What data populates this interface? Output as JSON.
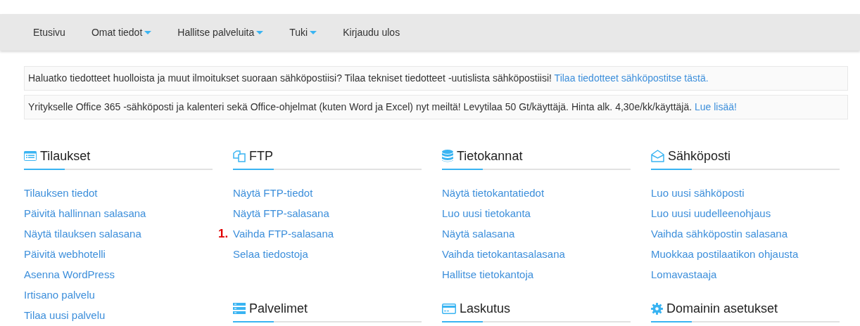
{
  "nav": [
    {
      "label": "Etusivu",
      "dropdown": false
    },
    {
      "label": "Omat tiedot",
      "dropdown": true
    },
    {
      "label": "Hallitse palveluita",
      "dropdown": true
    },
    {
      "label": "Tuki",
      "dropdown": true
    },
    {
      "label": "Kirjaudu ulos",
      "dropdown": false
    }
  ],
  "notices": [
    {
      "text": "Haluatko tiedotteet huolloista ja muut ilmoitukset suoraan sähköpostiisi? Tilaa tekniset tiedotteet -uutislista sähköpostiisi!",
      "link": "Tilaa tiedotteet sähköpostitse tästä."
    },
    {
      "text": "Yritykselle Office 365 -sähköposti ja kalenteri sekä Office-ohjelmat (kuten Word ja Excel) nyt meiltä! Levytilaa 50 Gt/käyttäjä. Hinta alk. 4,30e/kk/käyttäjä.",
      "link": "Lue lisää!"
    }
  ],
  "columns": [
    {
      "sections": [
        {
          "title": "Tilaukset",
          "kind": "list",
          "links": [
            {
              "label": "Tilauksen tiedot"
            },
            {
              "label": "Päivitä hallinnan salasana"
            },
            {
              "label": "Näytä tilauksen salasana"
            },
            {
              "label": "Päivitä webhotelli"
            },
            {
              "label": "Asenna WordPress"
            },
            {
              "label": "Irtisano palvelu"
            },
            {
              "label": "Tilaa uusi palvelu"
            }
          ]
        }
      ]
    },
    {
      "sections": [
        {
          "title": "FTP",
          "kind": "files",
          "links": [
            {
              "label": "Näytä FTP-tiedot"
            },
            {
              "label": "Näytä FTP-salasana"
            },
            {
              "label": "Vaihda FTP-salasana",
              "marker": "1."
            },
            {
              "label": "Selaa tiedostoja"
            }
          ]
        },
        {
          "title": "Palvelimet",
          "kind": "server"
        }
      ]
    },
    {
      "sections": [
        {
          "title": "Tietokannat",
          "kind": "database",
          "links": [
            {
              "label": "Näytä tietokantatiedot"
            },
            {
              "label": "Luo uusi tietokanta"
            },
            {
              "label": "Näytä salasana"
            },
            {
              "label": "Vaihda tietokantasalasana"
            },
            {
              "label": "Hallitse tietokantoja"
            }
          ]
        },
        {
          "title": "Laskutus",
          "kind": "card"
        }
      ]
    },
    {
      "sections": [
        {
          "title": "Sähköposti",
          "kind": "envelope",
          "links": [
            {
              "label": "Luo uusi sähköposti"
            },
            {
              "label": "Luo uusi uudelleenohjaus"
            },
            {
              "label": "Vaihda sähköpostin salasana"
            },
            {
              "label": "Muokkaa postilaatikon ohjausta"
            },
            {
              "label": "Lomavastaaja"
            }
          ]
        },
        {
          "title": "Domainin asetukset",
          "kind": "gear"
        }
      ]
    }
  ]
}
